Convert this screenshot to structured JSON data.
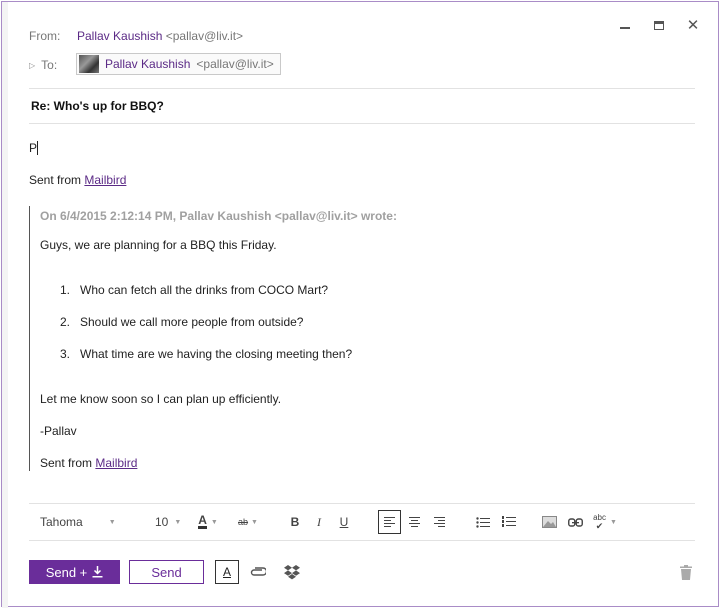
{
  "window": {
    "controls": {
      "minimize": "",
      "maximize": "",
      "close": "✕"
    }
  },
  "header": {
    "from_label": "From:",
    "from_name": "Pallav Kaushish",
    "from_address": "<pallav@liv.it>",
    "to_label": "To:",
    "to_name": "Pallav Kaushish",
    "to_address": "<pallav@liv.it>"
  },
  "subject": "Re: Who's up for BBQ?",
  "body": {
    "typed_text": "P",
    "signature_prefix": "Sent from",
    "signature_link": "Mailbird"
  },
  "quote": {
    "attribution": "On 6/4/2015 2:12:14 PM, Pallav Kaushish <pallav@liv.it> wrote:",
    "intro": "Guys, we are planning for a BBQ this Friday.",
    "items": [
      {
        "num": "1.",
        "text": "Who can fetch all the drinks from COCO Mart?"
      },
      {
        "num": "2.",
        "text": "Should we call more people from outside?"
      },
      {
        "num": "3.",
        "text": "What time are we having the closing meeting then?"
      }
    ],
    "closing": "Let me know soon so I can plan up efficiently.",
    "sign": "-Pallav",
    "signature_prefix": "Sent from",
    "signature_link": "Mailbird"
  },
  "toolbar": {
    "font": "Tahoma",
    "size": "10",
    "font_color_glyph": "A",
    "highlight_glyph": "ab",
    "bold": "B",
    "italic": "I",
    "underline": "U",
    "spell_glyph": "abc"
  },
  "actions": {
    "send_plus_label": "Send +",
    "send_label": "Send",
    "format_toggle": "A"
  },
  "colors": {
    "accent": "#6a2d9a",
    "link": "#5b2a86",
    "quote_attrib": "#a0a0a0"
  }
}
